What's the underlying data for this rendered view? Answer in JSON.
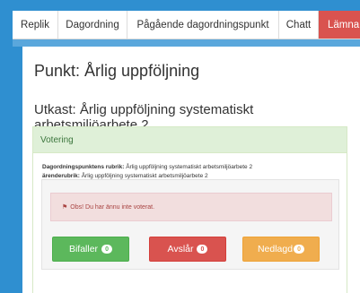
{
  "nav": {
    "tabs": [
      "Replik",
      "Dagordning",
      "Pågående dagordningspunkt",
      "Chatt",
      "Lämna"
    ]
  },
  "panel": {
    "title": "Punkt: Årlig uppföljning",
    "draft_title": "Utkast: Årlig uppföljning systematiskt arbetsmiljöarbete 2"
  },
  "vote": {
    "heading": "Votering",
    "rubric_label": "Dagordningspunktens rubrik:",
    "rubric_value": "Årlig uppföljning systematiskt arbetsmiljöarbete 2",
    "subrubric_label": "ärenderubrik:",
    "subrubric_value": "Årlig uppföljning systematiskt arbetsmiljöarbete 2",
    "alert": "Obs! Du har ännu inte voterat.",
    "buttons": [
      {
        "label": "Bifaller",
        "count": "0"
      },
      {
        "label": "Avslår",
        "count": "0"
      },
      {
        "label": "Nedlagd",
        "count": "0"
      }
    ]
  },
  "icons": {
    "alert": "flag-icon"
  },
  "colors": {
    "background": "#2f8fd0",
    "leave": "#d9534f",
    "approve": "#5cb85c",
    "reject": "#d9534f",
    "abstain": "#f0ad4e",
    "vote_heading": "#dff0d8"
  }
}
